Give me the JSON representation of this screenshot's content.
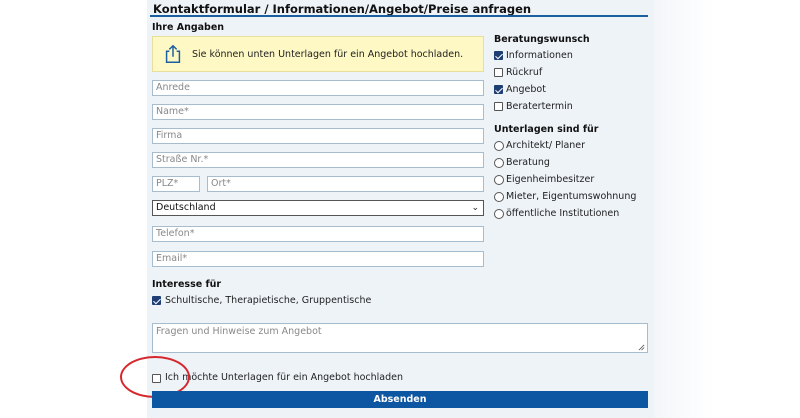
{
  "form": {
    "title": "Kontaktformular / Informationen/Angebot/Preise anfragen",
    "section_ihre_angaben": "Ihre Angaben",
    "notice_text": "Sie können unten Unterlagen für ein Angebot hochladen.",
    "fields": {
      "anrede": "Anrede",
      "name": "Name*",
      "firma": "Firma",
      "strasse": "Straße Nr.*",
      "plz": "PLZ*",
      "ort": "Ort*",
      "land": "Deutschland",
      "telefon": "Telefon*",
      "email": "Email*"
    },
    "interesse_heading": "Interesse für",
    "interesse_option": "Schultische, Therapietische, Gruppentische",
    "interesse_checked": true,
    "message_placeholder": "Fragen und Hinweise zum Angebot",
    "upload_checkbox_label": "Ich möchte Unterlagen für ein Angebot hochladen",
    "submit_label": "Absenden"
  },
  "beratung": {
    "heading": "Beratungswunsch",
    "options": [
      {
        "label": "Informationen",
        "checked": true
      },
      {
        "label": "Rückruf",
        "checked": false
      },
      {
        "label": "Angebot",
        "checked": true
      },
      {
        "label": "Beratertermin",
        "checked": false
      }
    ]
  },
  "unterlagen": {
    "heading": "Unterlagen sind für",
    "options": [
      {
        "label": "Architekt/ Planer"
      },
      {
        "label": "Beratung"
      },
      {
        "label": "Eigenheimbesitzer"
      },
      {
        "label": "Mieter, Eigentumswohnung"
      },
      {
        "label": "öffentliche Institutionen"
      }
    ]
  },
  "colors": {
    "accent": "#0d57a2",
    "highlight_circle": "#d6282c",
    "notice_bg": "#fdf8c4"
  }
}
